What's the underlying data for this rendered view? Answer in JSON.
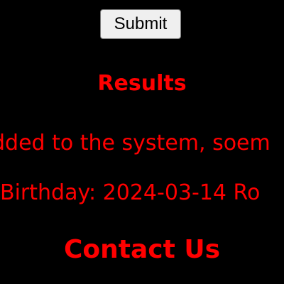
{
  "colors": {
    "background": "#000000",
    "text": "#ff0000",
    "button_background": "#efefef",
    "button_text": "#000000"
  },
  "form": {
    "submit_label": "Submit"
  },
  "results": {
    "heading": "Results",
    "lines": [
      "dded to the system, soem",
      "Birthday: 2024-03-14 Ro"
    ]
  },
  "contact": {
    "heading": "Contact Us"
  }
}
